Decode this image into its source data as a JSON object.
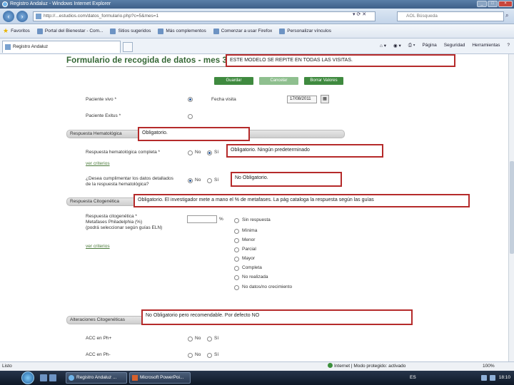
{
  "window": {
    "title": "Registro Andaluz - Windows Internet Explorer"
  },
  "browser": {
    "url": "http://...estudios.com/datos_formulario.php?c=5&mes=1",
    "search_placeholder": "AOL Búsqueda",
    "favorites_label": "Favoritos",
    "favorites": [
      "Portal del Bienestar - Com...",
      "Sitios sugeridos",
      "Más complementos",
      "Comenzar a usar Firefox",
      "Personalizar vínculos"
    ],
    "tab_label": "Registro Andaluz",
    "commands": [
      "Página",
      "Seguridad",
      "Herramientas"
    ]
  },
  "form": {
    "title": "Formulario de recogida de datos - mes 3",
    "buttons": {
      "save": "Guardar",
      "cancel": "Cancelar",
      "clear": "Borrar Valores"
    },
    "rows": {
      "paciente_vivo": "Paciente vivo *",
      "fecha_visita": "Fecha visita",
      "fecha_value": "17/08/2011",
      "paciente_exitus": "Paciente Exitus *",
      "resp_hemat": "Respuesta hematológica completa *",
      "no": "No",
      "si": "Sí",
      "ver_criterios": "ver criterios",
      "cumplimentar_1": "¿Desea cumplimentar los datos detallados",
      "cumplimentar_2": "de la respuesta hematológica?",
      "resp_cito_1": "Respuesta citogenética *",
      "resp_cito_2": "Metafases Philadelphia (%)",
      "resp_cito_3": "(podrá seleccionar según guías ELN)",
      "pct": "%",
      "acc_ph_pos": "ACC en Ph+",
      "acc_ph_neg": "ACC en Ph-"
    },
    "sections": {
      "hematologica": "Respuesta Hematológica",
      "citogenetica": "Respuesta Citogenética",
      "alteraciones": "Alteraciones Citogenéticas"
    },
    "cito_options": [
      "Sin respuesta",
      "Mínima",
      "Menor",
      "Parcial",
      "Mayor",
      "Completa",
      "No realizada",
      "No datos/no crecimiento"
    ]
  },
  "callouts": {
    "modelo": "ESTE MODELO SE REPITE EN TODAS LAS VISITAS.",
    "obligatorio": "Obligatorio.",
    "obligatorio_ninguno": "Obligatorio.  Ningún predeterminado",
    "no_obligatorio": "No Obligatorio.",
    "citogenetica": "Obligatorio. El investigador mete a mano el % de metafases. La pág cataloga la respuesta según las guías",
    "recomendable": "No Obligatorio pero recomendable. Por defecto NO"
  },
  "status": {
    "left": "Listo",
    "zone": "Internet | Modo protegido: activado",
    "zoom": "100%"
  },
  "taskbar": {
    "buttons": [
      "Registro Andaluz ...",
      "Microsoft PowerPoi..."
    ],
    "lang": "ES",
    "clock": "18:10"
  },
  "colors": {
    "title_green": "#336633",
    "button_green": "#3f8a3f",
    "callout_border": "#b52a2a"
  }
}
